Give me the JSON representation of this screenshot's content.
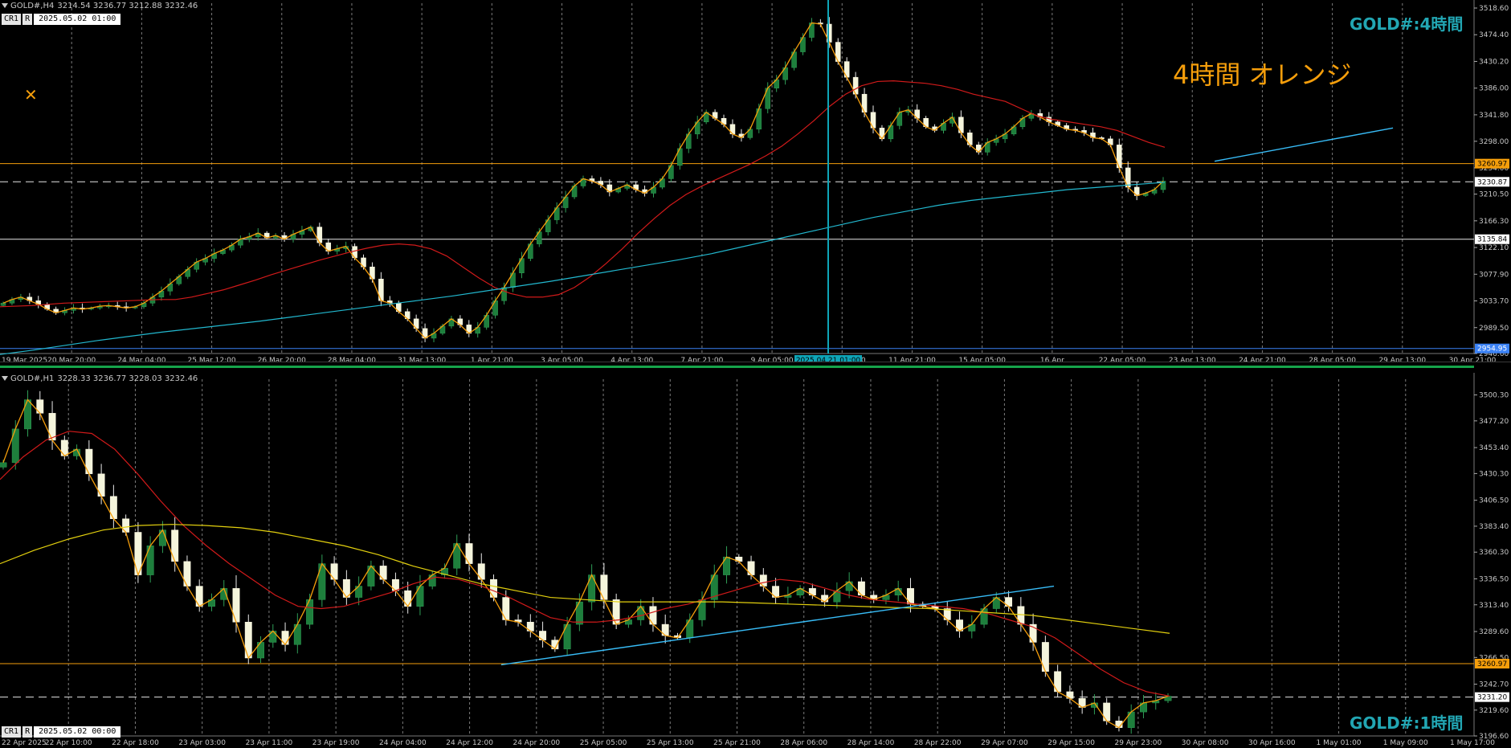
{
  "top_pane": {
    "header": {
      "symbol_tf": "GOLD#,H4",
      "ohlc": "3214.54 3236.77 3212.88 3232.46"
    },
    "tag_cr1": "CR1",
    "tag_r": "R",
    "datetime": "2025.05.02 01:00",
    "watermark": "GOLD#:4時間",
    "annotation": "4時間 オレンジ",
    "crosshair_label": "2025.04.21 01:00"
  },
  "bottom_pane": {
    "header": {
      "symbol_tf": "GOLD#,H1",
      "ohlc": "3228.33 3236.77 3228.03 3232.46"
    },
    "tag_cr1": "CR1",
    "tag_r": "R",
    "datetime": "2025.05.02 00:00",
    "watermark": "GOLD#:1時間"
  },
  "colors": {
    "background": "#000000",
    "bull": "#1e7f3c",
    "bear": "#f5f5dc",
    "ma_red": "#d11a1a",
    "ma_cyan": "#22b8cf",
    "ma_yellow": "#e3d00e",
    "zigzag": "#f59e0b",
    "level_orange": "#f59e0b",
    "level_white": "#e5e5e5",
    "level_blue": "#3b82f6",
    "trendline": "#38bdf8",
    "grid": "#9a9a9a",
    "crosshair": "#0ea5b7"
  },
  "chart_data": [
    {
      "type": "candlestick",
      "timeframe": "H4",
      "ylim": [
        2946.6,
        3518.6
      ],
      "y_ticks": [
        3518.6,
        3474.4,
        3430.2,
        3386.0,
        3341.8,
        3298.0,
        3254.0,
        3210.5,
        3166.3,
        3122.1,
        3077.9,
        3033.7,
        2989.5,
        2946.6
      ],
      "y_tick_labels": [
        "3518.60",
        "3474.40",
        "3430.20",
        "3386.00",
        "3341.80",
        "3298.00",
        "3254.00",
        "3210.50",
        "3166.30",
        "3122.10",
        "3077.90",
        "3033.70",
        "2989.50",
        "2946.60"
      ],
      "x_labels": [
        "19 Mar 2025",
        "20 Mar 20:00",
        "24 Mar 04:00",
        "25 Mar 12:00",
        "26 Mar 20:00",
        "28 Mar 04:00",
        "31 Mar 13:00",
        "1 Apr 21:00",
        "3 Apr 05:00",
        "4 Apr 13:00",
        "7 Apr 21:00",
        "9 Apr 05:00",
        "10 Apr 13:00",
        "11 Apr 21:00",
        "15 Apr 05:00",
        "16 Apr",
        "22 Apr 05:00",
        "23 Apr 13:00",
        "24 Apr 21:00",
        "28 Apr 05:00",
        "29 Apr 13:00",
        "30 Apr 21:00"
      ],
      "levels": [
        {
          "value": 3260.97,
          "label": "3260.97",
          "color": "orange",
          "style": "solid"
        },
        {
          "value": 3230.87,
          "label": "3230.87",
          "color": "white",
          "style": "dashed"
        },
        {
          "value": 3135.84,
          "label": "3135.84",
          "color": "white",
          "style": "solid"
        },
        {
          "value": 2954.95,
          "label": "2954.95",
          "color": "blue",
          "style": "solid"
        }
      ],
      "path": [
        3030,
        3036,
        3040,
        3034,
        3028,
        3020,
        3014,
        3018,
        3022,
        3020,
        3022,
        3025,
        3026,
        3024,
        3022,
        3024,
        3030,
        3040,
        3050,
        3062,
        3074,
        3086,
        3098,
        3104,
        3112,
        3118,
        3126,
        3136,
        3140,
        3146,
        3138,
        3142,
        3136,
        3144,
        3150,
        3156,
        3130,
        3116,
        3120,
        3124,
        3105,
        3090,
        3070,
        3034,
        3030,
        3016,
        3004,
        2988,
        2972,
        2980,
        2992,
        3004,
        2994,
        2980,
        2990,
        3010,
        3034,
        3056,
        3080,
        3104,
        3128,
        3148,
        3168,
        3188,
        3206,
        3224,
        3236,
        3232,
        3226,
        3214,
        3220,
        3226,
        3218,
        3212,
        3222,
        3236,
        3258,
        3286,
        3310,
        3330,
        3346,
        3336,
        3326,
        3310,
        3304,
        3318,
        3352,
        3386,
        3400,
        3420,
        3446,
        3470,
        3494,
        3492,
        3462,
        3430,
        3404,
        3376,
        3346,
        3320,
        3302,
        3324,
        3346,
        3350,
        3336,
        3322,
        3316,
        3328,
        3338,
        3312,
        3292,
        3280,
        3296,
        3302,
        3310,
        3322,
        3336,
        3344,
        3338,
        3330,
        3324,
        3318,
        3316,
        3312,
        3304,
        3302,
        3292,
        3254,
        3222,
        3208,
        3212,
        3218,
        3232
      ],
      "ma_red": [
        3024,
        3025,
        3026,
        3028,
        3030,
        3031,
        3032,
        3033,
        3034,
        3035,
        3036,
        3036,
        3040,
        3046,
        3052,
        3060,
        3068,
        3077,
        3085,
        3093,
        3101,
        3108,
        3115,
        3121,
        3126,
        3128,
        3126,
        3120,
        3108,
        3090,
        3072,
        3056,
        3046,
        3040,
        3040,
        3044,
        3056,
        3074,
        3096,
        3120,
        3146,
        3170,
        3192,
        3210,
        3224,
        3236,
        3248,
        3260,
        3274,
        3290,
        3310,
        3332,
        3356,
        3376,
        3390,
        3397,
        3398,
        3396,
        3394,
        3390,
        3384,
        3376,
        3370,
        3364,
        3352,
        3340,
        3334,
        3330,
        3326,
        3322,
        3316,
        3306,
        3296,
        3288
      ],
      "ma_cyan": [
        2945,
        2952,
        2960,
        2968,
        2975,
        2982,
        2988,
        2994,
        3000,
        3007,
        3014,
        3021,
        3028,
        3035,
        3042,
        3050,
        3058,
        3066,
        3075,
        3084,
        3093,
        3102,
        3112,
        3124,
        3136,
        3148,
        3160,
        3172,
        3182,
        3192,
        3200,
        3206,
        3212,
        3218,
        3222,
        3226,
        3230
      ],
      "trendline": {
        "from": [
          0.824,
          3265
        ],
        "to": [
          0.945,
          3320
        ]
      }
    },
    {
      "type": "candlestick",
      "timeframe": "H1",
      "ylim": [
        3196.6,
        3510.0
      ],
      "y_ticks": [
        3500.3,
        3477.2,
        3453.4,
        3430.3,
        3406.5,
        3383.4,
        3360.3,
        3336.5,
        3313.4,
        3289.6,
        3266.5,
        3242.7,
        3219.6,
        3196.6
      ],
      "y_tick_labels": [
        "3500.30",
        "3477.20",
        "3453.40",
        "3430.30",
        "3406.50",
        "3383.40",
        "3360.30",
        "3336.50",
        "3313.40",
        "3289.60",
        "3266.50",
        "3242.70",
        "3219.60",
        "3196.60"
      ],
      "x_labels": [
        "22 Apr 2025",
        "22 Apr 10:00",
        "22 Apr 18:00",
        "23 Apr 03:00",
        "23 Apr 11:00",
        "23 Apr 19:00",
        "24 Apr 04:00",
        "24 Apr 12:00",
        "24 Apr 20:00",
        "25 Apr 05:00",
        "25 Apr 13:00",
        "25 Apr 21:00",
        "28 Apr 06:00",
        "28 Apr 14:00",
        "28 Apr 22:00",
        "29 Apr 07:00",
        "29 Apr 15:00",
        "29 Apr 23:00",
        "30 Apr 08:00",
        "30 Apr 16:00",
        "1 May 01:00",
        "1 May 09:00",
        "1 May 17:00"
      ],
      "levels": [
        {
          "value": 3260.97,
          "label": "3260.97",
          "color": "orange",
          "style": "solid"
        },
        {
          "value": 3231.2,
          "label": "3231.20",
          "color": "white",
          "style": "dashed"
        }
      ],
      "path": [
        3440,
        3470,
        3496,
        3484,
        3460,
        3446,
        3452,
        3430,
        3410,
        3390,
        3378,
        3340,
        3366,
        3380,
        3352,
        3330,
        3312,
        3318,
        3328,
        3298,
        3266,
        3280,
        3290,
        3278,
        3296,
        3318,
        3350,
        3336,
        3320,
        3330,
        3348,
        3336,
        3326,
        3312,
        3330,
        3340,
        3346,
        3368,
        3350,
        3336,
        3320,
        3300,
        3298,
        3290,
        3282,
        3274,
        3296,
        3316,
        3340,
        3318,
        3296,
        3300,
        3312,
        3296,
        3286,
        3284,
        3300,
        3318,
        3340,
        3356,
        3352,
        3340,
        3330,
        3320,
        3322,
        3328,
        3322,
        3316,
        3326,
        3334,
        3322,
        3318,
        3322,
        3328,
        3314,
        3312,
        3310,
        3300,
        3290,
        3296,
        3310,
        3320,
        3312,
        3296,
        3280,
        3254,
        3236,
        3230,
        3222,
        3226,
        3210,
        3204,
        3218,
        3226,
        3228,
        3232
      ],
      "ma_red": [
        3425,
        3445,
        3460,
        3468,
        3466,
        3452,
        3430,
        3406,
        3384,
        3366,
        3350,
        3336,
        3322,
        3312,
        3310,
        3312,
        3318,
        3324,
        3332,
        3338,
        3336,
        3330,
        3322,
        3312,
        3302,
        3298,
        3298,
        3300,
        3304,
        3310,
        3314,
        3320,
        3326,
        3332,
        3336,
        3334,
        3328,
        3322,
        3318,
        3316,
        3314,
        3312,
        3310,
        3306,
        3300,
        3294,
        3284,
        3270,
        3256,
        3244,
        3236,
        3232
      ],
      "ma_yellow": [
        3350,
        3362,
        3372,
        3380,
        3384,
        3385,
        3384,
        3382,
        3378,
        3372,
        3366,
        3358,
        3348,
        3340,
        3332,
        3326,
        3320,
        3318,
        3316,
        3316,
        3316,
        3316,
        3315,
        3314,
        3313,
        3312,
        3311,
        3310,
        3308,
        3306,
        3304,
        3300,
        3296,
        3292,
        3288
      ],
      "trendline": {
        "from": [
          0.34,
          3260
        ],
        "to": [
          0.715,
          3330
        ]
      }
    }
  ]
}
